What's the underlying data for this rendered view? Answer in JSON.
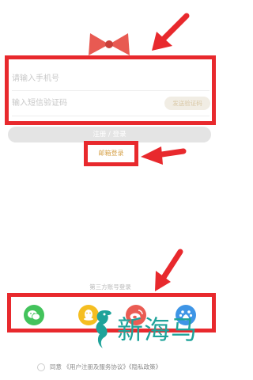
{
  "form": {
    "phone_placeholder": "请输入手机号",
    "code_placeholder": "输入短信验证码",
    "send_code_label": "发送验证码",
    "login_label": "注册 / 登录",
    "email_login_label": "邮箱登录"
  },
  "third_party": {
    "heading": "第三方账号登录",
    "providers": [
      "wechat-icon",
      "qq-icon",
      "weibo-icon",
      "baidu-icon"
    ]
  },
  "agreement": {
    "prefix": "同意",
    "terms_link": "《用户注册及服务协议》",
    "privacy_link": "《隐私政策》"
  },
  "watermark": {
    "text": "新海马"
  },
  "colors": {
    "annotation": "#e8292d",
    "accent": "#d6a24a",
    "wechat": "#43c35c",
    "qq": "#f5be21",
    "weibo": "#ea5c53",
    "baidu": "#3e95e6"
  }
}
